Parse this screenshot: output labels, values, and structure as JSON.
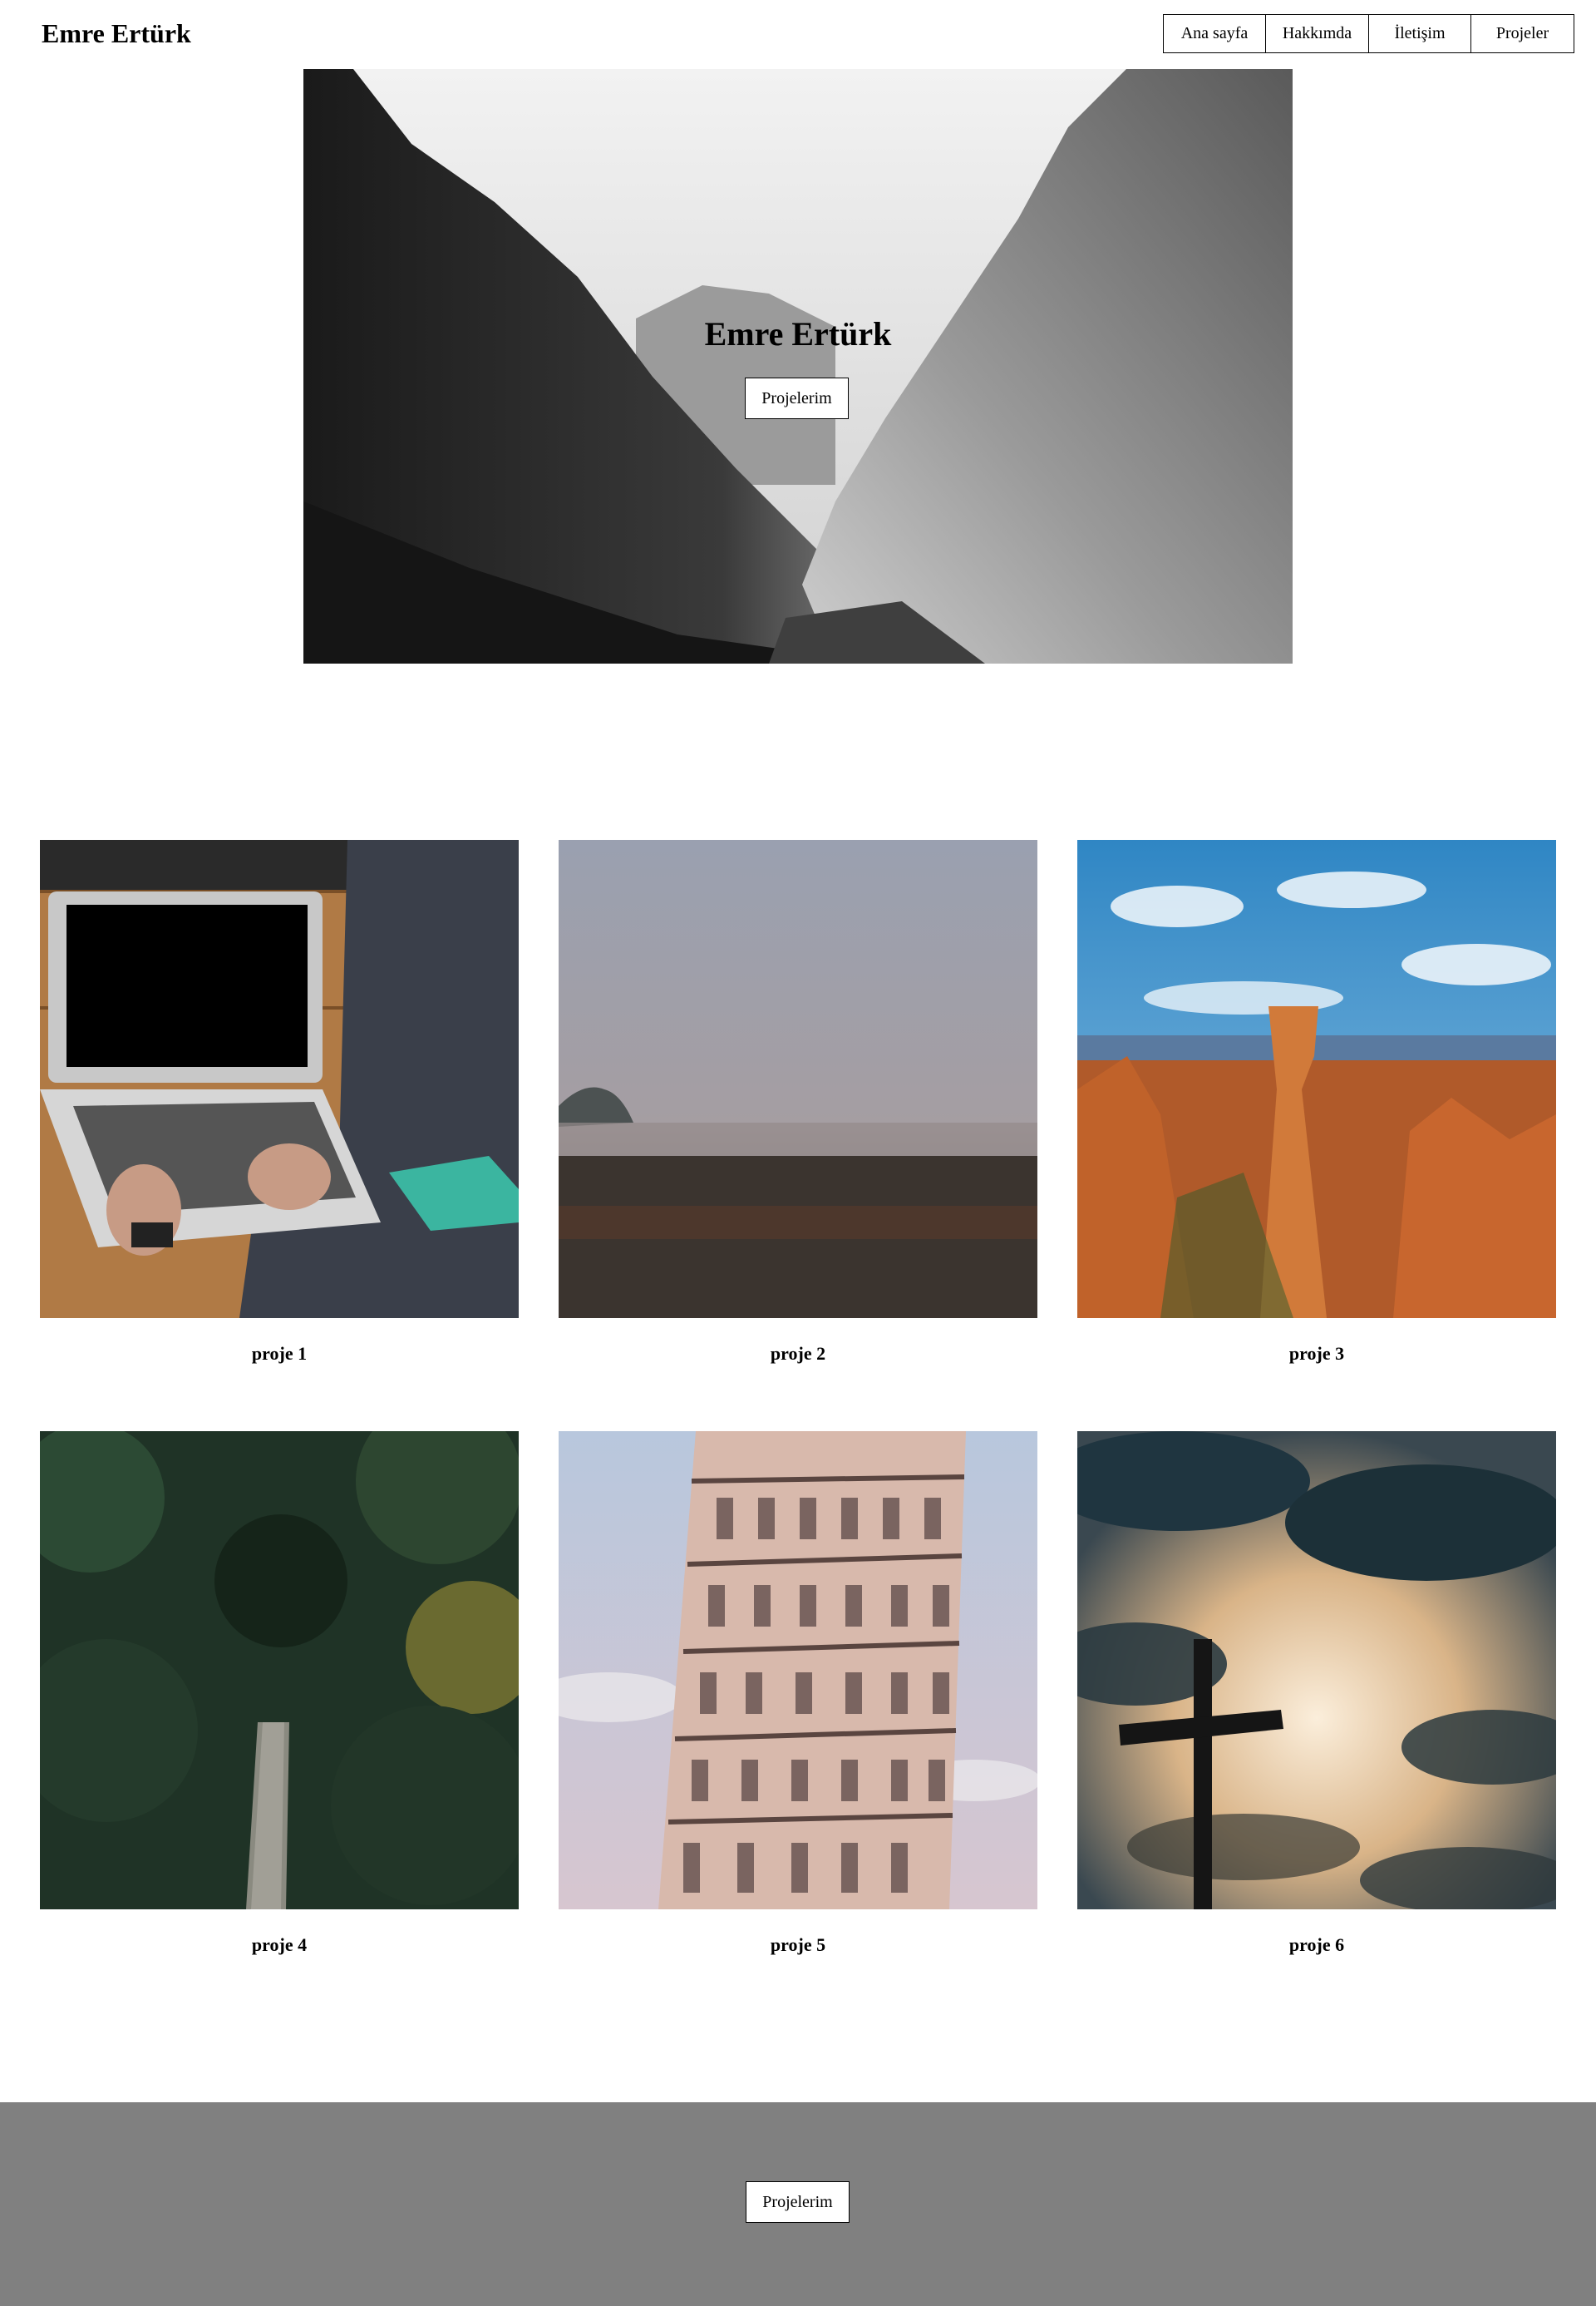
{
  "header": {
    "brand": "Emre Ertürk",
    "nav": [
      "Ana sayfa",
      "Hakkımda",
      "İletişim",
      "Projeler"
    ]
  },
  "hero": {
    "title": "Emre Ertürk",
    "button_label": "Projelerim",
    "image_icon": "mountain-valley-photo"
  },
  "projects": [
    {
      "label": "proje 1",
      "image_icon": "laptop-photo"
    },
    {
      "label": "proje 2",
      "image_icon": "foggy-field-photo"
    },
    {
      "label": "proje 3",
      "image_icon": "canyon-photo"
    },
    {
      "label": "proje 4",
      "image_icon": "forest-bridge-photo"
    },
    {
      "label": "proje 5",
      "image_icon": "leaning-tower-photo"
    },
    {
      "label": "proje 6",
      "image_icon": "cross-sky-photo"
    }
  ],
  "footer": {
    "button_label": "Projelerim",
    "background": "#808080"
  }
}
